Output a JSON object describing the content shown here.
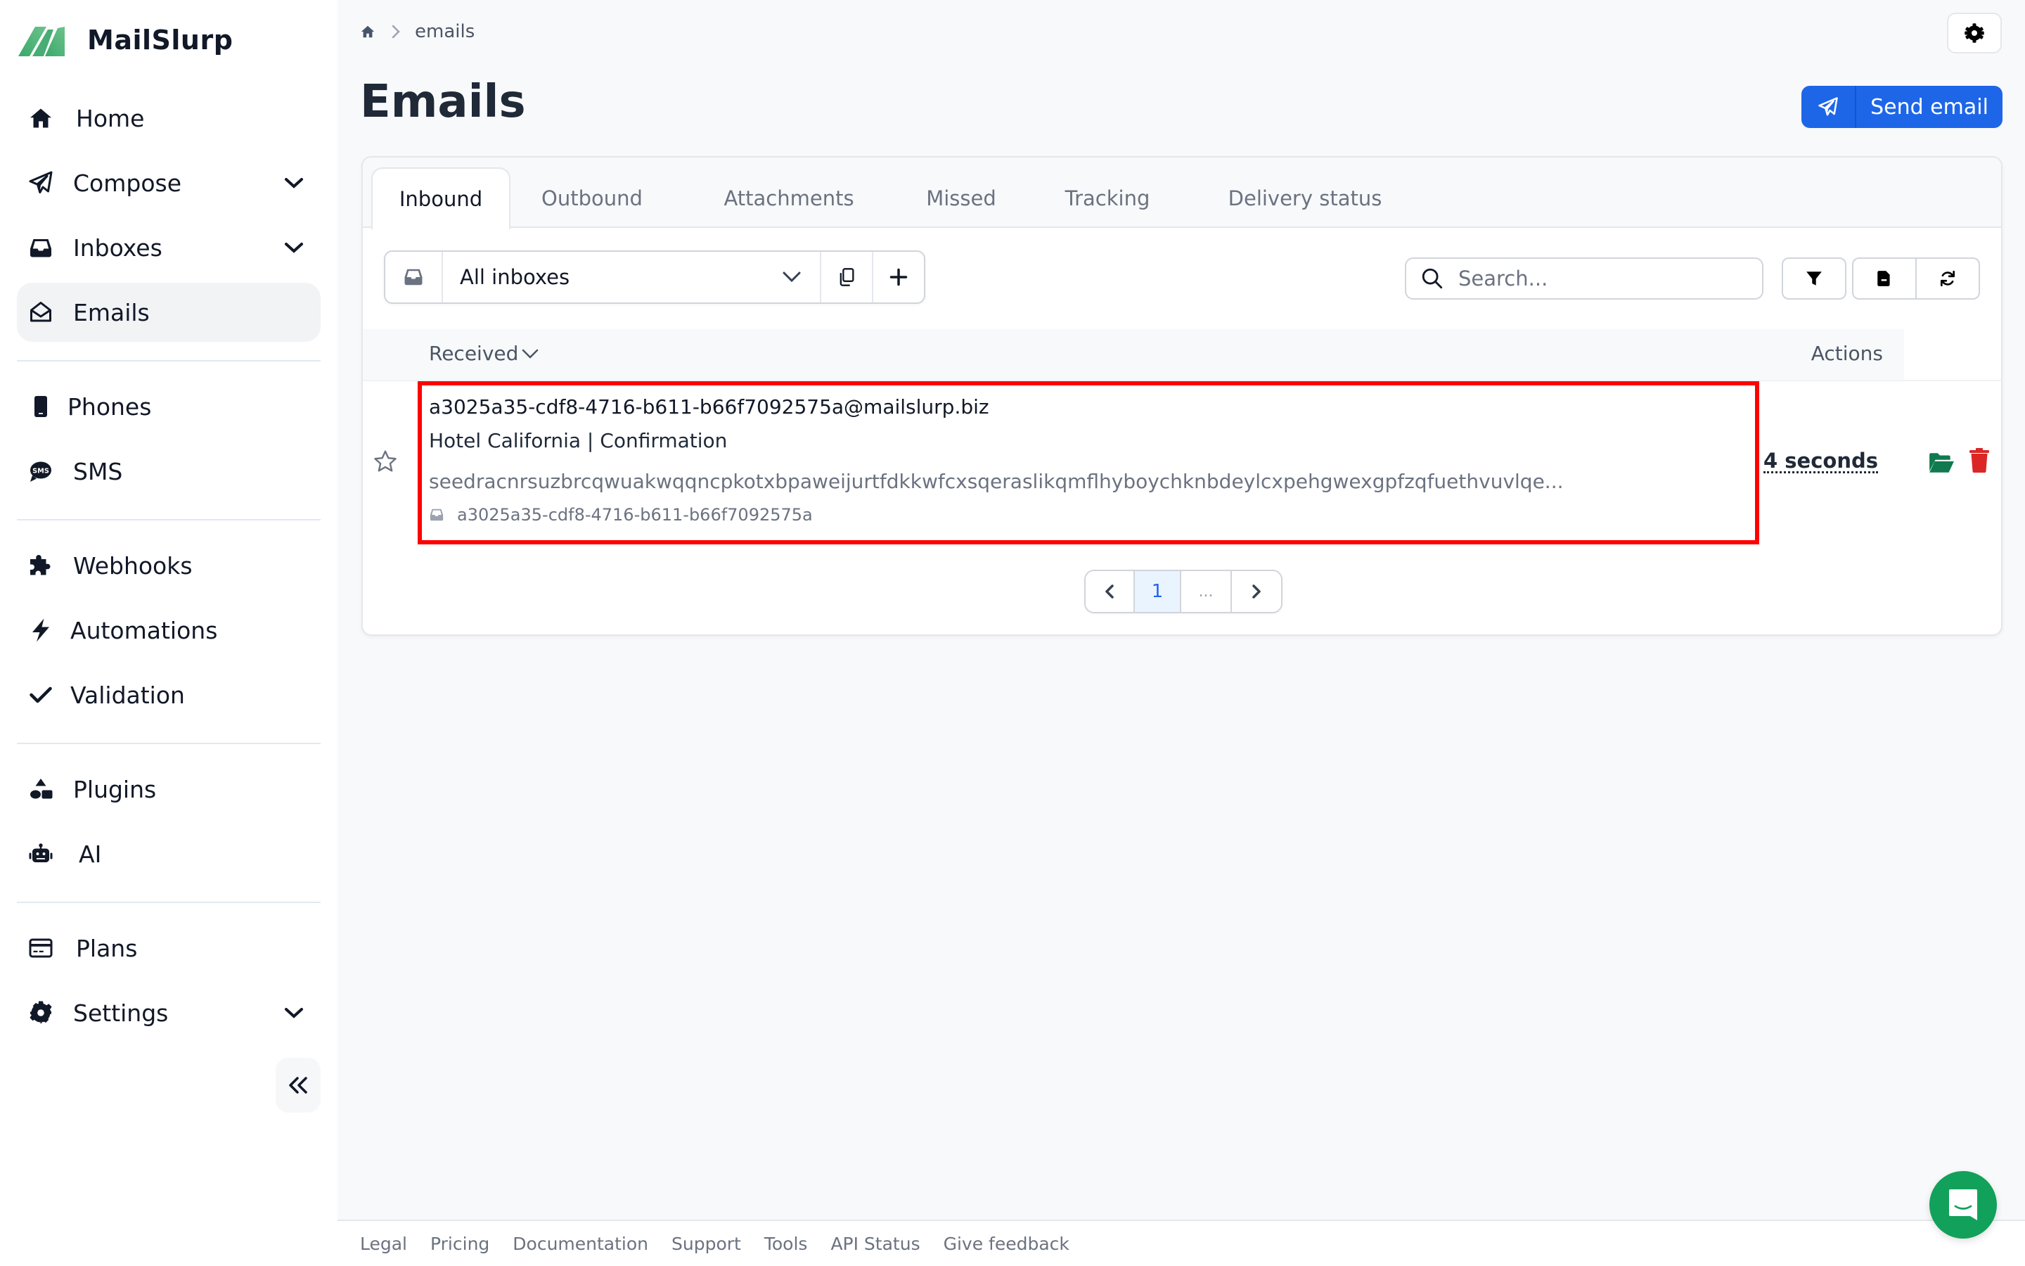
{
  "app": {
    "brand": "MailSlurp",
    "brand_color": "#4fb77a"
  },
  "sidebar": {
    "items": [
      {
        "label": "Home",
        "icon": "home-icon"
      },
      {
        "label": "Compose",
        "icon": "paper-plane-icon",
        "expandable": true
      },
      {
        "label": "Inboxes",
        "icon": "inbox-icon",
        "expandable": true
      },
      {
        "label": "Emails",
        "icon": "envelope-open-icon",
        "active": true
      },
      {
        "label": "Phones",
        "icon": "mobile-phone-icon"
      },
      {
        "label": "SMS",
        "icon": "sms-icon"
      },
      {
        "label": "Webhooks",
        "icon": "puzzle-icon"
      },
      {
        "label": "Automations",
        "icon": "bolt-icon"
      },
      {
        "label": "Validation",
        "icon": "check-icon"
      },
      {
        "label": "Plugins",
        "icon": "shapes-icon"
      },
      {
        "label": "AI",
        "icon": "robot-icon"
      },
      {
        "label": "Plans",
        "icon": "credit-card-icon"
      },
      {
        "label": "Settings",
        "icon": "gear-icon",
        "expandable": true
      }
    ],
    "collapse_icon": "double-chevron-left-icon"
  },
  "breadcrumb": {
    "home_icon": "home-icon",
    "current": "emails"
  },
  "header": {
    "title": "Emails",
    "send_email_label": "Send email",
    "send_email_color": "#1d66e8"
  },
  "tabs": [
    {
      "label": "Inbound",
      "active": true
    },
    {
      "label": "Outbound"
    },
    {
      "label": "Attachments"
    },
    {
      "label": "Missed"
    },
    {
      "label": "Tracking"
    },
    {
      "label": "Delivery status"
    }
  ],
  "toolbar": {
    "inbox_select_value": "All inboxes",
    "search_placeholder": "Search...",
    "search_value": ""
  },
  "table": {
    "columns": {
      "received": "Received",
      "actions": "Actions"
    },
    "rows": [
      {
        "to": "a3025a35-cdf8-4716-b611-b66f7092575a@mailslurp.biz",
        "subject": "Hotel California | Confirmation",
        "body_preview": "seedracnrsuzbrcqwuakwqqncpkotxbpaweijurtfdkkwfcxsqeraslikqmflhyboychknbdeylcxpehgwexgpfzqfuethvuvlqe...",
        "inbox_id": "a3025a35-cdf8-4716-b611-b66f7092575a",
        "received": "4 seconds",
        "starred": false
      }
    ]
  },
  "pagination": {
    "current_page": "1",
    "ellipsis": "..."
  },
  "footer": {
    "links": [
      "Legal",
      "Pricing",
      "Documentation",
      "Support",
      "Tools",
      "API Status",
      "Give feedback"
    ]
  },
  "colors": {
    "highlight_border": "#ff0000",
    "open_action": "#0f7a4e",
    "delete_action": "#dc2626",
    "chat_button": "#12a15a"
  }
}
